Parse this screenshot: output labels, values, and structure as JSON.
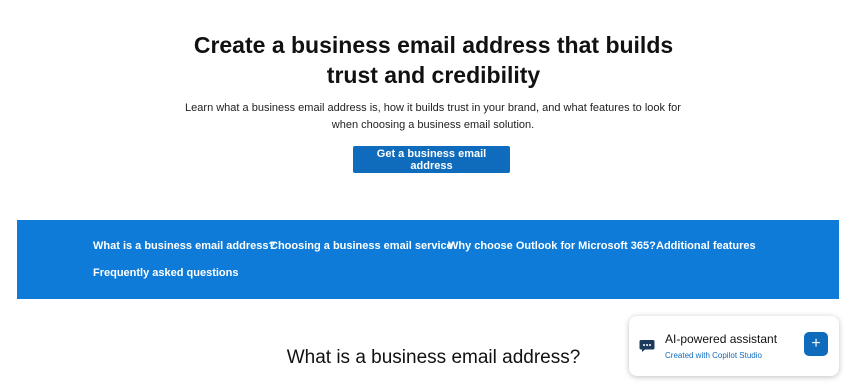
{
  "hero": {
    "title_line1": "Create a business email address that builds",
    "title_line2": "trust and credibility",
    "description_line1": "Learn what a business email address is, how it builds trust in your brand, and what features to look for",
    "description_line2": "when choosing a business email solution.",
    "cta_label": "Get a business email address"
  },
  "nav": {
    "items": [
      {
        "label": "What is a business email address?"
      },
      {
        "label": "Choosing a business email service"
      },
      {
        "label": "Why choose Outlook for Microsoft 365?"
      },
      {
        "label": "Additional features"
      },
      {
        "label": "Frequently asked questions"
      }
    ]
  },
  "section": {
    "heading": "What is a business email address?"
  },
  "assistant": {
    "title": "AI-powered assistant",
    "subtitle": "Created with Copilot Studio",
    "chat_icon": "chat-bubble-icon",
    "add_icon": "plus-icon",
    "add_symbol": "+"
  },
  "colors": {
    "accent": "#0f6cbd",
    "nav_background": "#0f7bd8"
  }
}
